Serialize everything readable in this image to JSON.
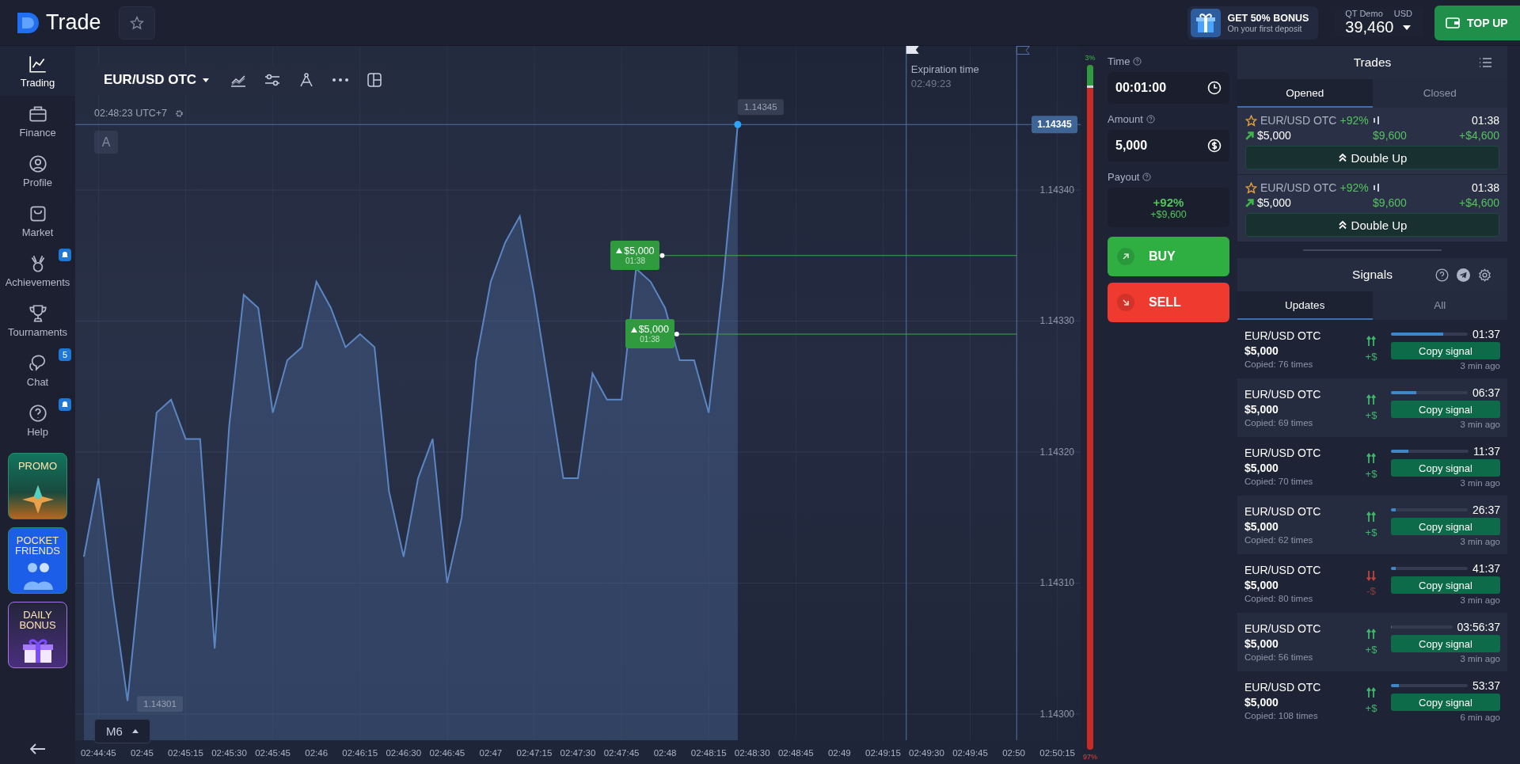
{
  "header": {
    "logo_text": "Trade",
    "bonus": {
      "title": "GET 50% BONUS",
      "subtitle": "On your first deposit"
    },
    "account": {
      "type": "QT Demo",
      "currency": "USD",
      "balance": "39,460"
    },
    "top_up_button": "TOP UP"
  },
  "sidebar": {
    "items": [
      {
        "label": "Trading",
        "selected": true
      },
      {
        "label": "Finance",
        "selected": false
      },
      {
        "label": "Profile",
        "selected": false
      },
      {
        "label": "Market",
        "selected": false
      },
      {
        "label": "Achievements",
        "selected": false,
        "badge": {
          "kind": "bell"
        }
      },
      {
        "label": "Tournaments",
        "selected": false
      },
      {
        "label": "Chat",
        "selected": false,
        "badge": {
          "kind": "count",
          "text": "5"
        }
      },
      {
        "label": "Help",
        "selected": false,
        "badge": {
          "kind": "bell"
        }
      }
    ],
    "promos": [
      {
        "kind": "promo",
        "label": "PROMO"
      },
      {
        "kind": "friends",
        "label": "POCKET FRIENDS"
      },
      {
        "kind": "daily",
        "label": "DAILY BONUS"
      }
    ]
  },
  "chart": {
    "asset": "EUR/USD OTC",
    "clock": "02:48:23 UTC+7",
    "drawing_label": "A",
    "timeframe": "M6",
    "expiration": {
      "label": "Expiration time",
      "time": "02:49:23"
    },
    "peak_label": "1.14345",
    "low_label": "1.14301",
    "trades": [
      {
        "kind": "up",
        "amount": "$5,000",
        "time": "01:38"
      },
      {
        "kind": "up",
        "amount": "$5,000",
        "time": "01:38"
      }
    ],
    "chart_data": {
      "type": "line",
      "categories": [
        null,
        "02:44:45",
        null,
        null,
        "02:45",
        null,
        null,
        "02:45:15",
        null,
        null,
        "02:45:30",
        null,
        null,
        "02:45:45",
        null,
        null,
        "02:46",
        null,
        null,
        "02:46:15",
        null,
        null,
        "02:46:30",
        null,
        null,
        "02:46:45",
        null,
        null,
        "02:47",
        null,
        null,
        "02:47:15",
        null,
        null,
        "02:47:30",
        null,
        null,
        "02:47:45",
        null,
        null,
        "02:48",
        null,
        null,
        "02:48:15",
        null,
        null,
        "02:48:30",
        null,
        null,
        "02:48:45",
        null,
        null,
        "02:49",
        null,
        null,
        "02:49:15",
        null,
        null,
        "02:49:30",
        null,
        null,
        "02:49:45",
        null,
        null,
        "02:50",
        null,
        null,
        "02:50:15",
        null
      ],
      "values": [
        1.14312,
        1.14318,
        1.14309,
        1.14301,
        1.14312,
        1.14323,
        1.14324,
        1.14321,
        1.14321,
        1.14305,
        1.14322,
        1.14332,
        1.14331,
        1.14323,
        1.14327,
        1.14328,
        1.14333,
        1.14331,
        1.14328,
        1.14329,
        1.14328,
        1.14317,
        1.14312,
        1.14318,
        1.14321,
        1.1431,
        1.14315,
        1.14327,
        1.14333,
        1.14336,
        1.14338,
        1.14332,
        1.14325,
        1.14318,
        1.14318,
        1.14326,
        1.14324,
        1.14324,
        1.14334,
        1.14333,
        1.14331,
        1.14327,
        1.14327,
        1.14323,
        1.14333,
        1.14345,
        null,
        null,
        null,
        null,
        null,
        null,
        null,
        null,
        null,
        null,
        null,
        null,
        null,
        null,
        null,
        null,
        null,
        null,
        null,
        null,
        null,
        null,
        null
      ],
      "ylim": [
        1.14298,
        1.14351
      ],
      "yticks": [
        {
          "value": 1.143,
          "label": "1.14300"
        },
        {
          "value": 1.1431,
          "label": "1.14310"
        },
        {
          "value": 1.1432,
          "label": "1.14320"
        },
        {
          "value": 1.1433,
          "label": "1.14330"
        },
        {
          "value": 1.1434,
          "label": "1.14340"
        }
      ],
      "grid": true,
      "ref_lines": [
        {
          "axis": "y",
          "value": 1.14345,
          "label": "1.14345"
        },
        {
          "axis": "y",
          "value": 1.14335
        },
        {
          "axis": "y",
          "value": 1.14329
        }
      ]
    }
  },
  "sentiment": {
    "up_label": "3%",
    "down_label": "97%",
    "level": 0.03
  },
  "trade_panel": {
    "time": {
      "label": "Time",
      "value": "00:01:00"
    },
    "amount": {
      "label": "Amount",
      "value": "5,000"
    },
    "payout": {
      "label": "Payout",
      "percent": "+92%",
      "profit": "+$9,600"
    },
    "buy_button": "BUY",
    "sell_button": "SELL"
  },
  "trades": {
    "title": "Trades",
    "tabs": [
      {
        "label": "Opened",
        "selected": true
      },
      {
        "label": "Closed",
        "selected": false
      }
    ],
    "items": [
      {
        "asset": "EUR/USD OTC",
        "payout": "+92%",
        "time": "01:38",
        "kind": "up",
        "amount": "$5,000",
        "payout_amount": "$9,600",
        "profit": "+$4,600",
        "button": "Double Up"
      },
      {
        "asset": "EUR/USD OTC",
        "payout": "+92%",
        "time": "01:38",
        "kind": "up",
        "amount": "$5,000",
        "payout_amount": "$9,600",
        "profit": "+$4,600",
        "button": "Double Up"
      }
    ]
  },
  "signals": {
    "title": "Signals",
    "tabs": [
      {
        "label": "Updates",
        "selected": true
      },
      {
        "label": "All",
        "selected": false
      }
    ],
    "items": [
      {
        "pair": "EUR/USD OTC",
        "amount": "$5,000",
        "copied": "Copied: 76 times",
        "kind": "up",
        "change": "+$",
        "level": 0.68,
        "time": "01:37",
        "button": "Copy signal",
        "ago": "3 min ago"
      },
      {
        "pair": "EUR/USD OTC",
        "amount": "$5,000",
        "copied": "Copied: 69 times",
        "kind": "up",
        "change": "+$",
        "level": 0.33,
        "time": "06:37",
        "button": "Copy signal",
        "ago": "3 min ago"
      },
      {
        "pair": "EUR/USD OTC",
        "amount": "$5,000",
        "copied": "Copied: 70 times",
        "kind": "up",
        "change": "+$",
        "level": 0.22,
        "time": "11:37",
        "button": "Copy signal",
        "ago": "3 min ago"
      },
      {
        "pair": "EUR/USD OTC",
        "amount": "$5,000",
        "copied": "Copied: 62 times",
        "kind": "up",
        "change": "+$",
        "level": 0.06,
        "time": "26:37",
        "button": "Copy signal",
        "ago": "3 min ago"
      },
      {
        "pair": "EUR/USD OTC",
        "amount": "$5,000",
        "copied": "Copied: 80 times",
        "kind": "down",
        "change": "-$",
        "level": 0.06,
        "time": "41:37",
        "button": "Copy signal",
        "ago": "3 min ago"
      },
      {
        "pair": "EUR/USD OTC",
        "amount": "$5,000",
        "copied": "Copied: 56 times",
        "kind": "up",
        "change": "+$",
        "level": 0,
        "time": "03:56:37",
        "button": "Copy signal",
        "ago": "3 min ago"
      },
      {
        "pair": "EUR/USD OTC",
        "amount": "$5,000",
        "copied": "Copied: 108 times",
        "kind": "up",
        "change": "+$",
        "level": 0.1,
        "time": "53:37",
        "button": "Copy signal",
        "ago": "6 min ago"
      }
    ]
  }
}
